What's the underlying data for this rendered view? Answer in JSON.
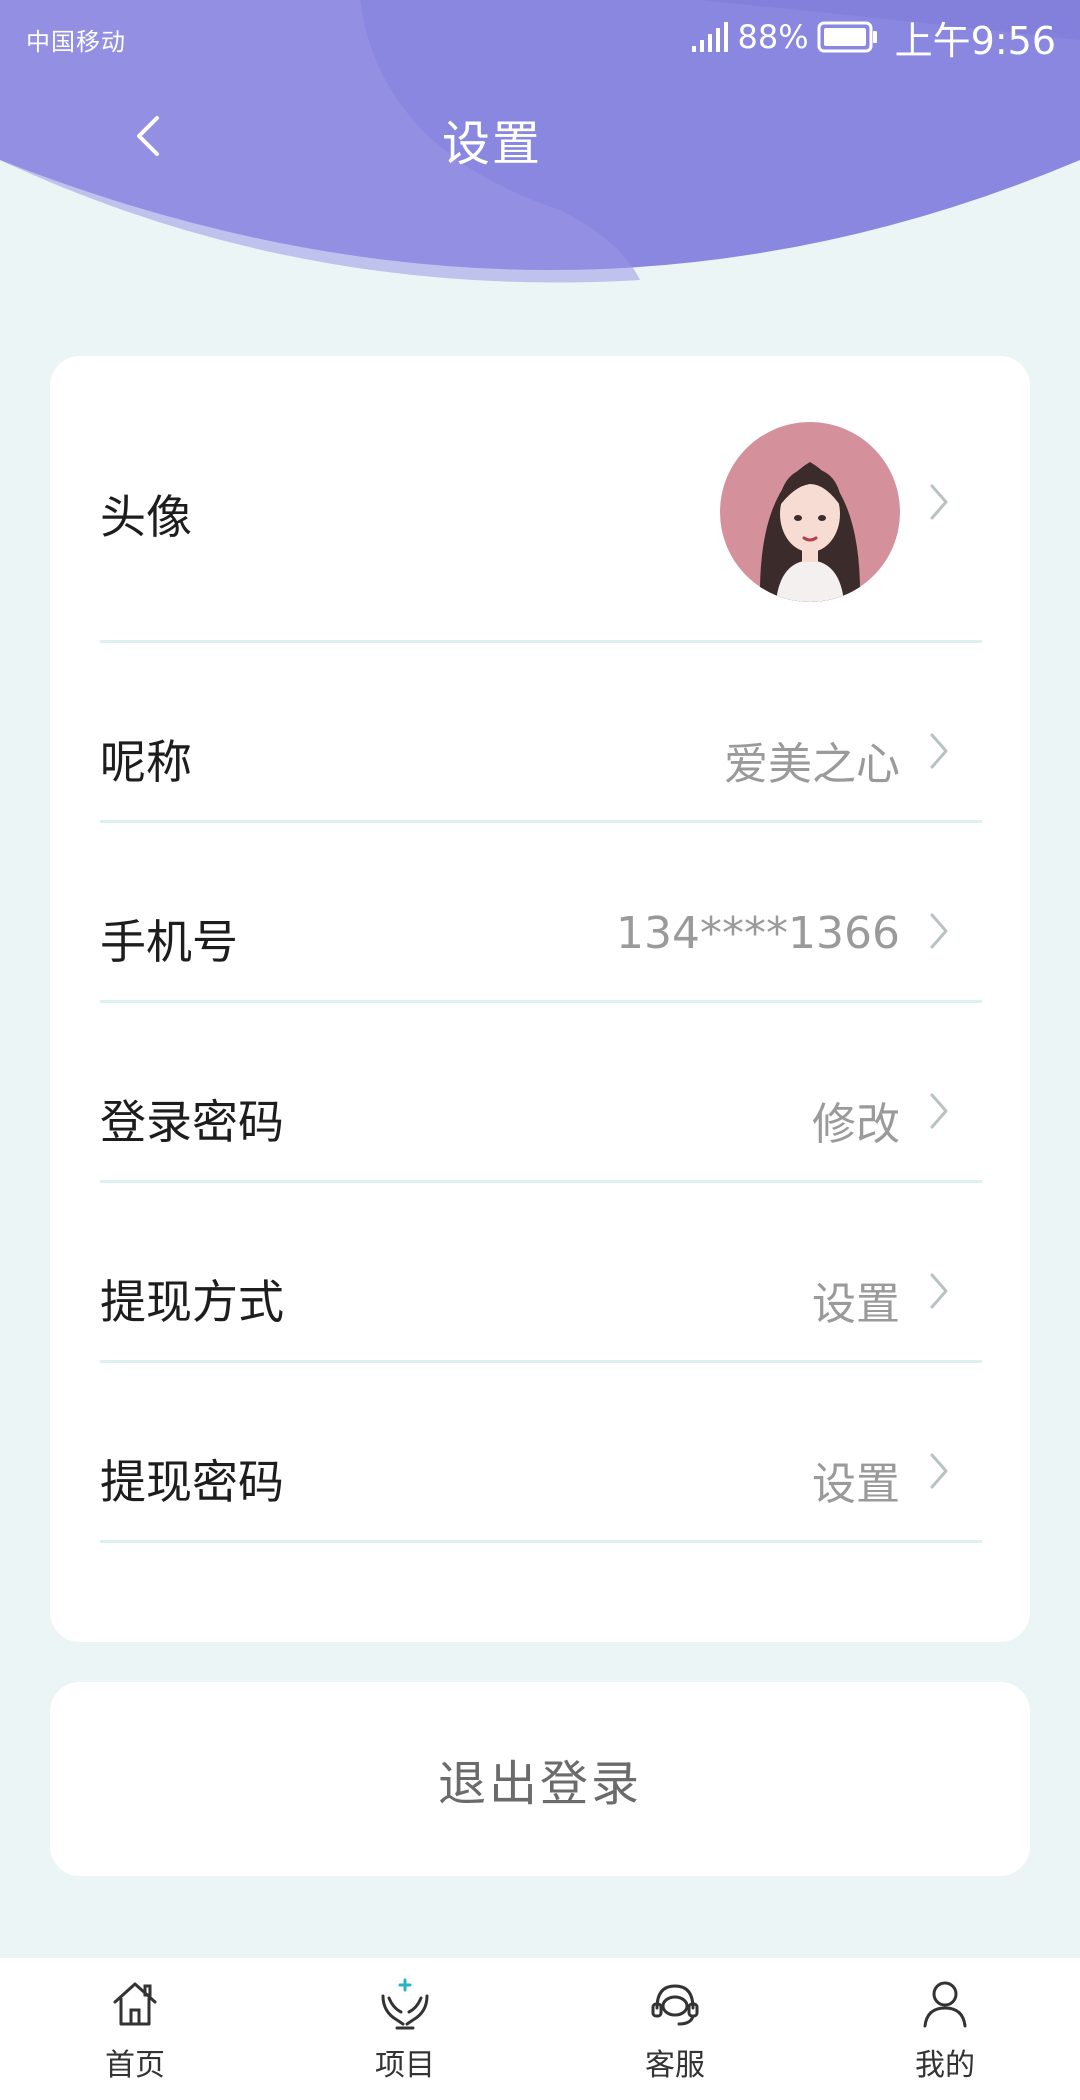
{
  "status_bar": {
    "carrier": "中国移动",
    "battery": "88%",
    "time": "上午9:56"
  },
  "header": {
    "title": "设置",
    "back_icon": "chevron-left-icon"
  },
  "settings": {
    "avatar_label": "头像",
    "nickname_label": "呢称",
    "nickname_value": "爱美之心",
    "phone_label": "手机号",
    "phone_value": "134****1366",
    "login_password_label": "登录密码",
    "login_password_value": "修改",
    "withdraw_method_label": "提现方式",
    "withdraw_method_value": "设置",
    "withdraw_password_label": "提现密码",
    "withdraw_password_value": "设置"
  },
  "logout": {
    "label": "退出登录"
  },
  "tabbar": {
    "items": [
      {
        "label": "首页",
        "icon": "home-icon"
      },
      {
        "label": "项目",
        "icon": "project-hands-icon"
      },
      {
        "label": "客服",
        "icon": "headset-icon"
      },
      {
        "label": "我的",
        "icon": "user-icon"
      }
    ]
  },
  "colors": {
    "header_purple": "#8482dd",
    "background": "#ecf5f6",
    "divider": "#dff0f1",
    "accent_teal": "#2ab3c0"
  }
}
